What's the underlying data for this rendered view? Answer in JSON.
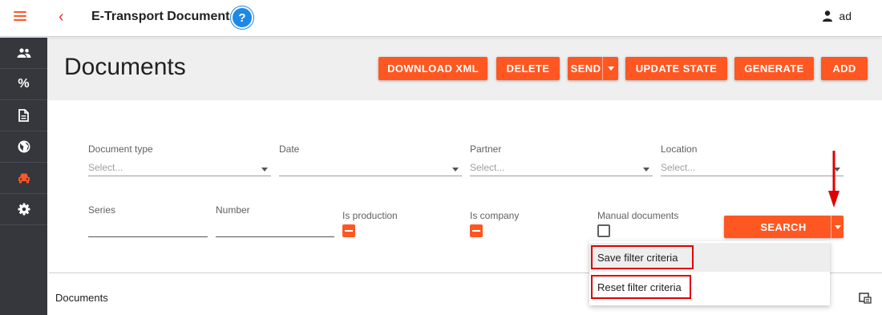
{
  "topbar": {
    "title": "E-Transport Documents",
    "user_name": "ad",
    "icons": [
      "menu-icon",
      "chevron-left-icon",
      "help-icon",
      "user-icon"
    ]
  },
  "sidebar": {
    "items": [
      {
        "icon": "people-icon",
        "label": ""
      },
      {
        "icon": "percent-icon",
        "label": "%"
      },
      {
        "icon": "document-icon",
        "label": ""
      },
      {
        "icon": "globe-icon",
        "label": ""
      },
      {
        "icon": "car-icon",
        "label": "",
        "active": true
      },
      {
        "icon": "gear-icon",
        "label": ""
      }
    ]
  },
  "page": {
    "title": "Documents"
  },
  "toolbar": {
    "download_xml": "DOWNLOAD XML",
    "delete": "DELETE",
    "send": "SEND",
    "update_state": "UPDATE STATE",
    "generate": "GENERATE",
    "add": "ADD"
  },
  "filters": {
    "document_type": {
      "label": "Document type",
      "placeholder": "Select..."
    },
    "date": {
      "label": "Date",
      "value": ""
    },
    "partner": {
      "label": "Partner",
      "placeholder": "Select..."
    },
    "location": {
      "label": "Location",
      "placeholder": "Select..."
    },
    "series": {
      "label": "Series",
      "value": ""
    },
    "number": {
      "label": "Number",
      "value": ""
    },
    "is_production": {
      "label": "Is production",
      "state": "indeterminate"
    },
    "is_company": {
      "label": "Is company",
      "state": "indeterminate"
    },
    "manual_documents": {
      "label": "Manual documents",
      "state": "unchecked"
    },
    "search_label": "SEARCH"
  },
  "search_menu": {
    "items": [
      {
        "label": "Save filter criteria"
      },
      {
        "label": "Reset filter criteria"
      }
    ]
  },
  "documents_section": {
    "label": "Documents"
  },
  "colors": {
    "accent": "#ff5722",
    "sidebar": "#36363d",
    "help": "#1e88e5",
    "highlight_box": "#e00000"
  }
}
